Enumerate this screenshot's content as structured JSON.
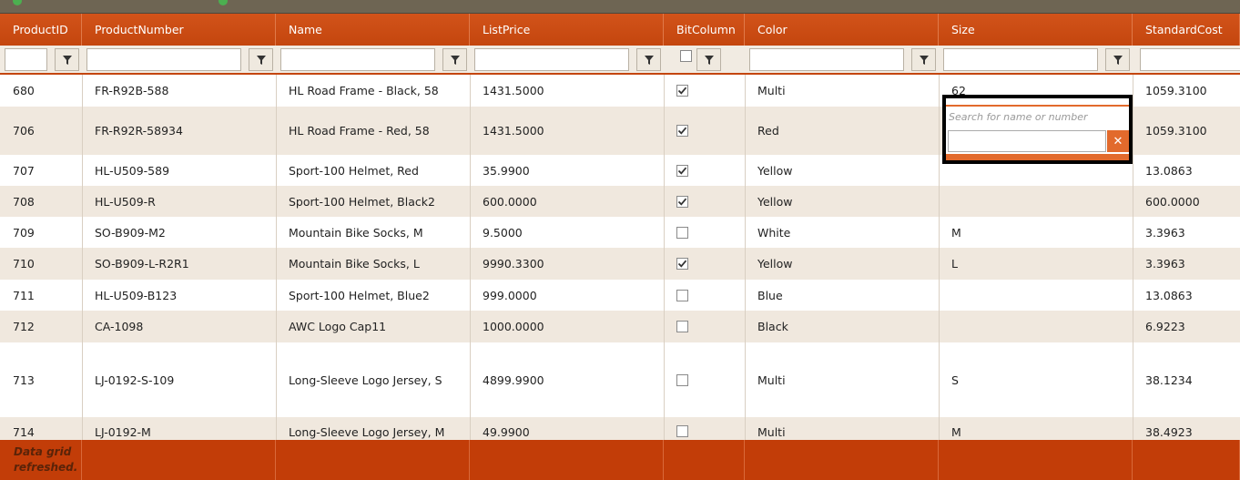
{
  "columns": [
    "ProductID",
    "ProductNumber",
    "Name",
    "ListPrice",
    "BitColumn",
    "Color",
    "Size",
    "StandardCost"
  ],
  "rows": [
    {
      "id": "680",
      "number": "FR-R92B-588",
      "name": "HL Road Frame - Black, 58",
      "price": "1431.5000",
      "bit": true,
      "color": "Multi",
      "size": "62",
      "cost": "1059.3100"
    },
    {
      "id": "706",
      "number": "FR-R92R-58934",
      "name": "HL Road Frame - Red, 58",
      "price": "1431.5000",
      "bit": true,
      "color": "Red",
      "size": "",
      "cost": "1059.3100"
    },
    {
      "id": "707",
      "number": "HL-U509-589",
      "name": "Sport-100 Helmet, Red",
      "price": "35.9900",
      "bit": true,
      "color": "Yellow",
      "size": "",
      "cost": "13.0863"
    },
    {
      "id": "708",
      "number": "HL-U509-R",
      "name": "Sport-100 Helmet, Black2",
      "price": "600.0000",
      "bit": true,
      "color": "Yellow",
      "size": "",
      "cost": "600.0000"
    },
    {
      "id": "709",
      "number": "SO-B909-M2",
      "name": "Mountain Bike Socks, M",
      "price": "9.5000",
      "bit": false,
      "color": "White",
      "size": "M",
      "cost": "3.3963"
    },
    {
      "id": "710",
      "number": "SO-B909-L-R2R1",
      "name": "Mountain Bike Socks, L",
      "price": "9990.3300",
      "bit": true,
      "color": "Yellow",
      "size": "L",
      "cost": "3.3963"
    },
    {
      "id": "711",
      "number": "HL-U509-B123",
      "name": "Sport-100 Helmet, Blue2",
      "price": "999.0000",
      "bit": false,
      "color": "Blue",
      "size": "",
      "cost": "13.0863"
    },
    {
      "id": "712",
      "number": "CA-1098",
      "name": "AWC Logo Cap11",
      "price": "1000.0000",
      "bit": false,
      "color": "Black",
      "size": "",
      "cost": "6.9223"
    },
    {
      "id": "713",
      "number": "LJ-0192-S-109",
      "name": "Long-Sleeve Logo Jersey, S",
      "price": "4899.9900",
      "bit": false,
      "color": "Multi",
      "size": "S",
      "cost": "38.1234"
    },
    {
      "id": "714",
      "number": "LJ-0192-M",
      "name": "Long-Sleeve Logo Jersey, M",
      "price": "49.9900",
      "bit": false,
      "color": "Multi",
      "size": "M",
      "cost": "38.4923"
    }
  ],
  "filter": {
    "bit_checked": false
  },
  "popup": {
    "placeholder": "Search for name or number",
    "clear_glyph": "✕"
  },
  "status": {
    "message": "Data grid refreshed."
  },
  "colors": {
    "header": "#c4460e",
    "footer": "#c23d08",
    "alt_row": "#f0e8de",
    "accent": "#e26a2c"
  },
  "icons": {
    "filter": "funnel-icon",
    "clear": "close-icon",
    "check": "checkmark-icon"
  }
}
